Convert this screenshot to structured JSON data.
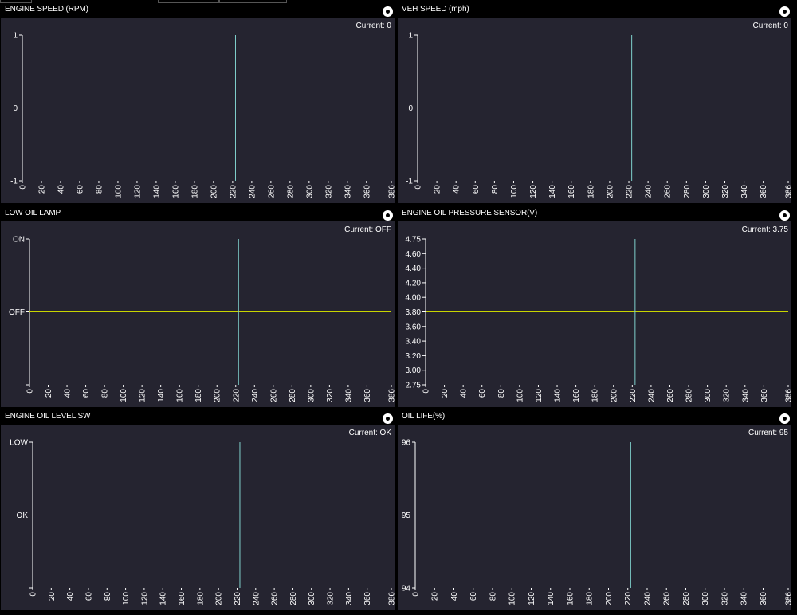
{
  "colors": {
    "background": "#000000",
    "plot_background": "#252430",
    "value_line": "#c8d400",
    "cursor_line": "#7fd0cc",
    "axis": "#ffffff"
  },
  "panels": [
    {
      "title": "ENGINE SPEED (RPM)",
      "current_label": "Current: 0",
      "button_icon": "radio-button-icon",
      "chart_data": {
        "type": "line",
        "x_ticks": [
          "0",
          "20",
          "40",
          "60",
          "80",
          "100",
          "120",
          "140",
          "160",
          "180",
          "200",
          "220",
          "240",
          "260",
          "280",
          "300",
          "320",
          "340",
          "360",
          "386"
        ],
        "x_range": [
          0,
          386
        ],
        "y_ticks": [
          "1",
          "0",
          "-1"
        ],
        "y_range": [
          -1,
          1
        ],
        "value": 0,
        "cursor_x": 223
      }
    },
    {
      "title": "VEH SPEED (mph)",
      "current_label": "Current: 0",
      "button_icon": "radio-button-icon",
      "chart_data": {
        "type": "line",
        "x_ticks": [
          "0",
          "20",
          "40",
          "60",
          "80",
          "100",
          "120",
          "140",
          "160",
          "180",
          "200",
          "220",
          "240",
          "260",
          "280",
          "300",
          "320",
          "340",
          "360",
          "386"
        ],
        "x_range": [
          0,
          386
        ],
        "y_ticks": [
          "1",
          "0",
          "-1"
        ],
        "y_range": [
          -1,
          1
        ],
        "value": 0,
        "cursor_x": 223
      }
    },
    {
      "title": "LOW OIL LAMP",
      "current_label": "Current: OFF",
      "button_icon": "radio-button-icon",
      "chart_data": {
        "type": "line",
        "x_ticks": [
          "0",
          "20",
          "40",
          "60",
          "80",
          "100",
          "120",
          "140",
          "160",
          "180",
          "200",
          "220",
          "240",
          "260",
          "280",
          "300",
          "320",
          "340",
          "360",
          "386"
        ],
        "x_range": [
          0,
          386
        ],
        "y_ticks": [
          "ON",
          "OFF",
          ""
        ],
        "y_range": [
          -1,
          1
        ],
        "value": 0,
        "cursor_x": 223
      }
    },
    {
      "title": "ENGINE OIL PRESSURE SENSOR(V)",
      "current_label": "Current: 3.75",
      "button_icon": "radio-button-icon",
      "chart_data": {
        "type": "line",
        "x_ticks": [
          "0",
          "20",
          "40",
          "60",
          "80",
          "100",
          "120",
          "140",
          "160",
          "180",
          "200",
          "220",
          "240",
          "260",
          "280",
          "300",
          "320",
          "340",
          "360",
          "386"
        ],
        "x_range": [
          0,
          386
        ],
        "y_ticks": [
          "4.75",
          "4.60",
          "4.40",
          "4.20",
          "4.00",
          "3.80",
          "3.60",
          "3.40",
          "3.20",
          "3.00",
          "2.75"
        ],
        "y_range": [
          2.75,
          4.75
        ],
        "value": 3.75,
        "cursor_x": 223
      }
    },
    {
      "title": "ENGINE OIL LEVEL SW",
      "current_label": "Current: OK",
      "button_icon": "radio-button-icon",
      "chart_data": {
        "type": "line",
        "x_ticks": [
          "0",
          "20",
          "40",
          "60",
          "80",
          "100",
          "120",
          "140",
          "160",
          "180",
          "200",
          "220",
          "240",
          "260",
          "280",
          "300",
          "320",
          "340",
          "360",
          "386"
        ],
        "x_range": [
          0,
          386
        ],
        "y_ticks": [
          "LOW",
          "OK",
          ""
        ],
        "y_range": [
          -1,
          1
        ],
        "value": 0,
        "cursor_x": 223
      }
    },
    {
      "title": "OIL LIFE(%)",
      "current_label": "Current: 95",
      "button_icon": "radio-button-icon",
      "chart_data": {
        "type": "line",
        "x_ticks": [
          "0",
          "20",
          "40",
          "60",
          "80",
          "100",
          "120",
          "140",
          "160",
          "180",
          "200",
          "220",
          "240",
          "260",
          "280",
          "300",
          "320",
          "340",
          "360",
          "386"
        ],
        "x_range": [
          0,
          386
        ],
        "y_ticks": [
          "96",
          "95",
          "94"
        ],
        "y_range": [
          94,
          96
        ],
        "value": 95,
        "cursor_x": 223
      }
    }
  ]
}
